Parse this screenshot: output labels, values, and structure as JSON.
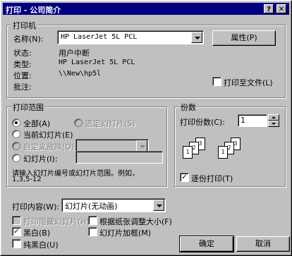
{
  "window": {
    "title": "打印 - 公司简介",
    "help_label": "?",
    "close_label": "✕"
  },
  "printer": {
    "group_label": "打印机",
    "name_label": "名称(N):",
    "name_value": "HP LaserJet 5L PCL",
    "properties_label": "属性(P)",
    "status_label": "状态:",
    "status_value": "用户中断",
    "type_label": "类型:",
    "type_value": "HP LaserJet 5L PCL",
    "location_label": "位置:",
    "location_value": "\\\\New\\hp5l",
    "comment_label": "批注:",
    "print_to_file_label": "打印至文件(L)"
  },
  "range": {
    "group_label": "打印范围",
    "all_label": "全部(A)",
    "selection_label": "选定幻灯片(S)",
    "current_label": "当前幻灯片(E)",
    "custom_show_label": "自定义放映(O):",
    "slides_label": "幻灯片(I):",
    "hint_line1": "请输入幻灯片编号或幻灯片范围。例如，",
    "hint_line2": "1,3,5-12"
  },
  "copies": {
    "group_label": "份数",
    "count_label": "打印份数(C):",
    "count_value": "1",
    "collate_label": "逐份打印(T)",
    "collate_checked": "✓"
  },
  "print_what": {
    "label": "打印内容(W):",
    "value": "幻灯片(无动画)"
  },
  "options": {
    "hidden_slides_label": "打印隐藏幻灯片(H)",
    "grayscale_label": "黑白(B)",
    "grayscale_checked": "✓",
    "pure_bw_label": "纯黑白(U)",
    "scale_to_fit_label": "根据纸张调整大小(F)",
    "frame_slides_label": "幻灯片加框(M)"
  },
  "buttons": {
    "ok_label": "确定",
    "cancel_label": "取消"
  },
  "collate_pages": [
    "1",
    "2",
    "3",
    "1",
    "2",
    "3"
  ]
}
